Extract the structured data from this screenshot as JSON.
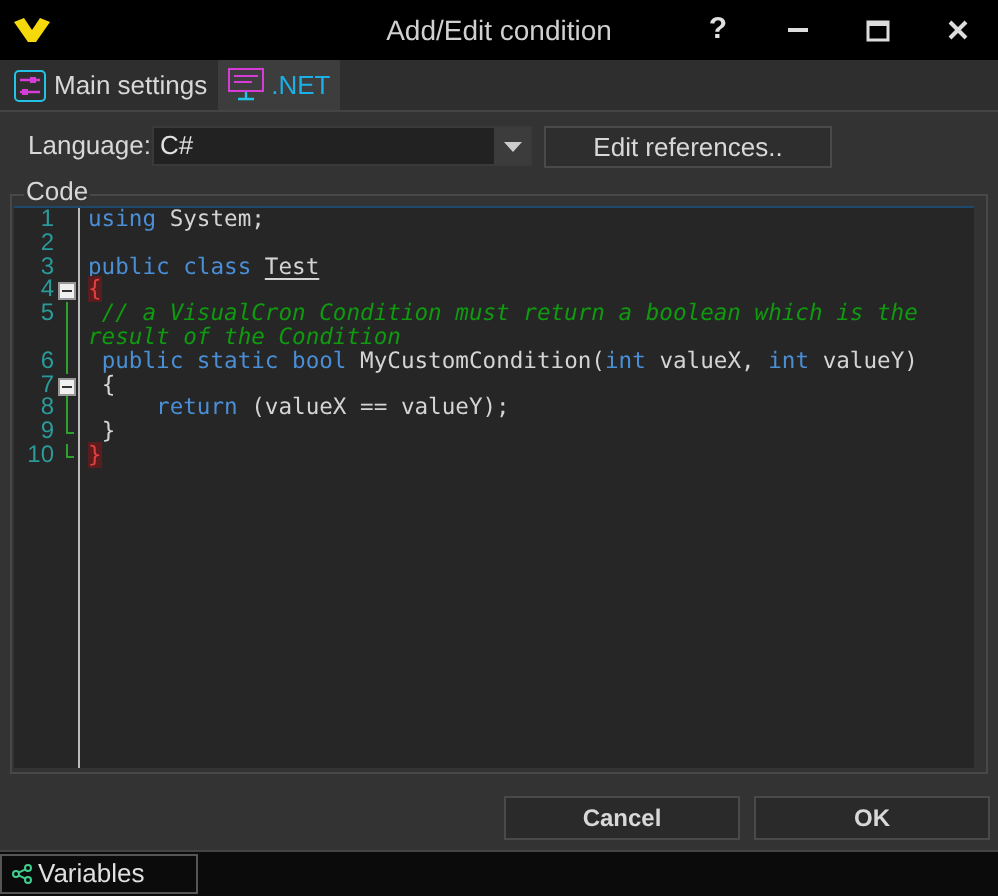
{
  "window": {
    "title": "Add/Edit condition",
    "controls": [
      "?"
    ]
  },
  "tabs": [
    {
      "label": "Main settings",
      "selected": false
    },
    {
      "label": ".NET",
      "selected": true
    }
  ],
  "language": {
    "label": "Language:",
    "value": "C#"
  },
  "edit_references_button": "Edit references..",
  "code_group": {
    "title": "Code"
  },
  "code_lines": [
    {
      "number": "1",
      "kind": "plain",
      "tokens": [
        {
          "text": "using",
          "kind": "keyword"
        },
        {
          "text": " System;",
          "kind": "plain"
        }
      ]
    },
    {
      "number": "2",
      "kind": "plain"
    },
    {
      "number": "3",
      "kind": "plain",
      "tokens": [
        {
          "text": "public class ",
          "kind": "keyword"
        },
        {
          "text": "Test",
          "kind": "type"
        }
      ]
    },
    {
      "number": "4",
      "kind": "fold_open",
      "tokens": [
        {
          "text": "{",
          "kind": "brace_match"
        }
      ]
    },
    {
      "number": "5",
      "kind": "fold_inner",
      "tokens": [
        {
          "text": " // a VisualCron Condition must return a boolean which is the result of the Condition",
          "kind": "comment"
        }
      ]
    },
    {
      "number": "6",
      "kind": "fold_inner",
      "tokens": [
        {
          "text": " public static bool",
          "kind": "keyword"
        },
        {
          "text": " MyCustomCondition(",
          "kind": "plain"
        },
        {
          "text": "int",
          "kind": "keyword"
        },
        {
          "text": " valueX, ",
          "kind": "plain"
        },
        {
          "text": "int",
          "kind": "keyword"
        },
        {
          "text": " valueY)",
          "kind": "plain"
        }
      ]
    },
    {
      "number": "7",
      "kind": "fold_open",
      "tokens": [
        {
          "text": " {",
          "kind": "plain"
        }
      ]
    },
    {
      "number": "8",
      "kind": "fold_inner",
      "tokens": [
        {
          "text": "     return",
          "kind": "keyword"
        },
        {
          "text": " (valueX == valueY);",
          "kind": "plain"
        }
      ]
    },
    {
      "number": "9",
      "kind": "fold_end",
      "tokens": [
        {
          "text": " }",
          "kind": "plain"
        }
      ]
    },
    {
      "number": "10",
      "kind": "fold_end",
      "tokens": [
        {
          "text": "}",
          "kind": "brace_match"
        }
      ]
    }
  ],
  "buttons": [
    {
      "label": "Cancel"
    },
    {
      "label": "OK"
    }
  ],
  "bottom_bar": {
    "variables_button": "Variables"
  }
}
